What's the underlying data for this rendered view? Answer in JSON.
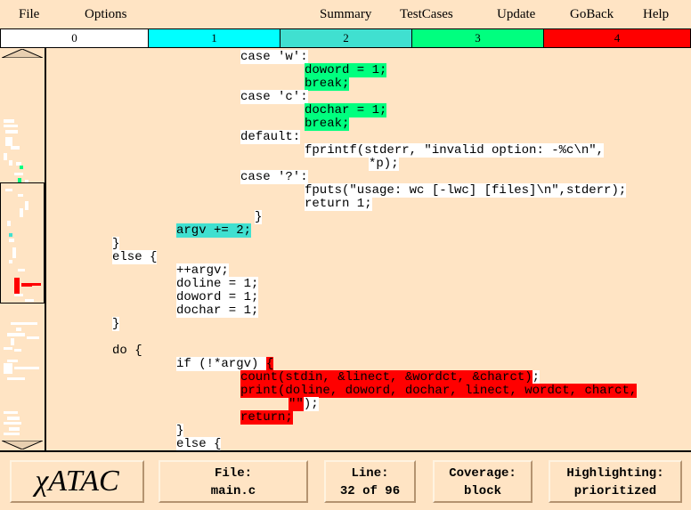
{
  "menu": {
    "file": "File",
    "options": "Options",
    "summary": "Summary",
    "testcases": "TestCases",
    "update": "Update",
    "goback": "GoBack",
    "help": "Help"
  },
  "legend": [
    {
      "label": "0",
      "color": "#ffffff"
    },
    {
      "label": "1",
      "color": "#00ffff"
    },
    {
      "label": "2",
      "color": "#40e0d0"
    },
    {
      "label": "3",
      "color": "#00ff7f"
    },
    {
      "label": "4",
      "color": "#ff0000"
    }
  ],
  "code_lines": [
    {
      "segs": [
        {
          "t": "case 'w':",
          "c": "w"
        }
      ]
    },
    {
      "segs": [
        {
          "t": "doword = 1;",
          "c": "g"
        }
      ]
    },
    {
      "segs": [
        {
          "t": "break;",
          "c": "g"
        }
      ]
    },
    {
      "segs": [
        {
          "t": "case 'c':",
          "c": "w"
        }
      ]
    },
    {
      "segs": [
        {
          "t": "dochar = 1;",
          "c": "g"
        }
      ]
    },
    {
      "segs": [
        {
          "t": "break;",
          "c": "g"
        }
      ]
    },
    {
      "segs": [
        {
          "t": "default:",
          "c": "w"
        }
      ]
    },
    {
      "segs": [
        {
          "t": "fprintf(stderr, \"invalid option: -%c\\n\",",
          "c": "w"
        }
      ]
    },
    {
      "segs": [
        {
          "t": "*p);",
          "c": "w"
        }
      ]
    },
    {
      "segs": [
        {
          "t": "case '?':",
          "c": "w"
        }
      ]
    },
    {
      "segs": [
        {
          "t": "fputs(\"usage: wc [-lwc] [files]\\n\",stderr);",
          "c": "w"
        }
      ]
    },
    {
      "segs": [
        {
          "t": "return 1;",
          "c": "w"
        }
      ]
    },
    {
      "segs": [
        {
          "t": "}",
          "c": "w"
        }
      ]
    },
    {
      "segs": [
        {
          "t": "argv += 2;",
          "c": "t"
        }
      ]
    },
    {
      "segs": [
        {
          "t": "}",
          "c": "w"
        }
      ]
    },
    {
      "segs": [
        {
          "t": "else {",
          "c": "w"
        }
      ]
    },
    {
      "segs": [
        {
          "t": "++argv;",
          "c": "w"
        }
      ]
    },
    {
      "segs": [
        {
          "t": "doline = 1;",
          "c": "w"
        }
      ]
    },
    {
      "segs": [
        {
          "t": "doword = 1;",
          "c": "w"
        }
      ]
    },
    {
      "segs": [
        {
          "t": "dochar = 1;",
          "c": "w"
        }
      ]
    },
    {
      "segs": [
        {
          "t": "}",
          "c": "w"
        }
      ]
    },
    {
      "segs": []
    },
    {
      "segs": [
        {
          "t": "do {",
          "c": "n"
        }
      ]
    },
    {
      "segs": [
        {
          "t": "if (!*argv) ",
          "c": "w"
        },
        {
          "t": "{",
          "c": "r"
        }
      ]
    },
    {
      "segs": [
        {
          "t": "count(stdin, &linect, &wordct, &charct)",
          "c": "r"
        },
        {
          "t": ";",
          "c": "w"
        }
      ]
    },
    {
      "segs": [
        {
          "t": "print(doline, doword, dochar, linect, wordct, charct,",
          "c": "r"
        }
      ]
    },
    {
      "segs": [
        {
          "t": "\"\"",
          "c": "r"
        },
        {
          "t": ");",
          "c": "w"
        }
      ]
    },
    {
      "segs": [
        {
          "t": "return;",
          "c": "r"
        }
      ]
    },
    {
      "segs": [
        {
          "t": "}",
          "c": "w"
        }
      ]
    },
    {
      "segs": [
        {
          "t": "else {",
          "c": "w"
        }
      ]
    }
  ],
  "status": {
    "logo": "χATAC",
    "file_title": "File:",
    "file_value": "main.c",
    "line_title": "Line:",
    "line_value": "32 of 96",
    "coverage_title": "Coverage:",
    "coverage_value": "block",
    "highlight_title": "Highlighting:",
    "highlight_value": "prioritized"
  },
  "colors": {
    "background": "#ffe4c4",
    "white": "#ffffff",
    "teal": "#40e0d0",
    "green": "#00ff7f",
    "red": "#ff0000"
  }
}
